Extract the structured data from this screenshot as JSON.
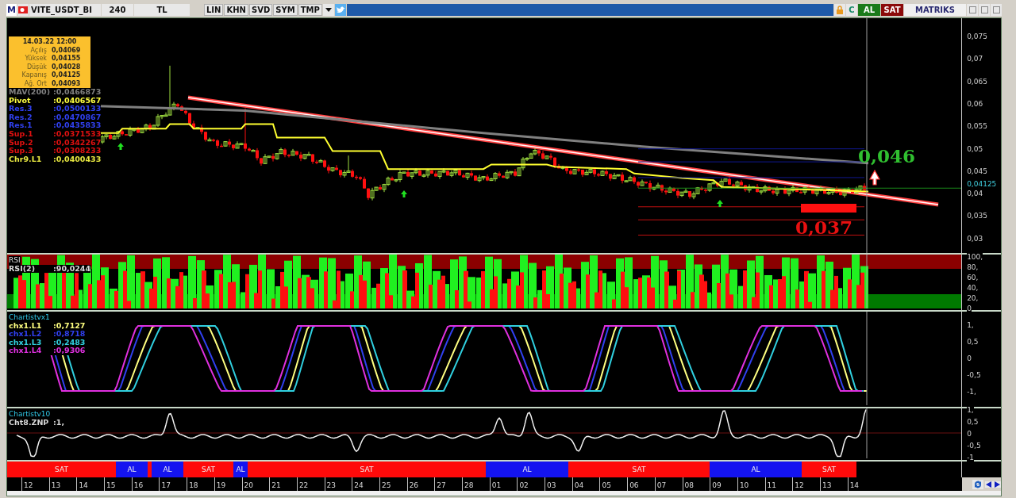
{
  "toolbar": {
    "logo": "M",
    "symbol": "VITE_USDT_BI",
    "period": "240",
    "currency": "TL",
    "chart_buttons": [
      "LIN",
      "KHN",
      "SVD",
      "SYM",
      "TMP"
    ],
    "refresh_button": "C",
    "buy_button": "AL",
    "sell_button": "SAT",
    "brand": "MATRIKS"
  },
  "info_box": {
    "datetime": "14.03.22 12:00",
    "rows": [
      {
        "label": "Açılış",
        "value": "0,04069"
      },
      {
        "label": "Yüksek",
        "value": "0,04155"
      },
      {
        "label": "Düşük",
        "value": "0,04028"
      },
      {
        "label": "Kapanış",
        "value": "0,04125"
      },
      {
        "label": "Ağ. Ort",
        "value": "0,04093"
      }
    ]
  },
  "price_panel": {
    "legend": [
      {
        "label": "MAV(200)",
        "value": ":0,0466873",
        "color": "#808080"
      },
      {
        "label": "Pivot",
        "value": ":0,0406567",
        "color": "#ffff40"
      },
      {
        "label": "Res.3",
        "value": ":0,0500133",
        "color": "#3040f0"
      },
      {
        "label": "Res.2",
        "value": ":0,0470867",
        "color": "#3040f0"
      },
      {
        "label": "Res.1",
        "value": ":0,0435833",
        "color": "#3040f0"
      },
      {
        "label": "Sup.1",
        "value": ":0,0371533",
        "color": "#e01010"
      },
      {
        "label": "Sup.2",
        "value": ":0,0342267",
        "color": "#e01010"
      },
      {
        "label": "Sup.3",
        "value": ":0,0308233",
        "color": "#e01010"
      },
      {
        "label": "Chr9.L1",
        "value": ":0,0400433",
        "color": "#e8e840"
      }
    ],
    "target_high": "0,046",
    "target_low": "0,037",
    "axis": [
      "0,075",
      "0,07",
      "0,065",
      "0,06",
      "0,055",
      "0,05",
      "0,045",
      "0,04",
      "0,035",
      "0,03"
    ],
    "last_price": "0,04125"
  },
  "rsi_panel": {
    "title": "RSI",
    "legend": [
      {
        "label": "RSI(2)",
        "value": ":90,0244"
      }
    ],
    "axis": [
      "100,",
      "80,",
      "60,",
      "40,",
      "20,",
      "0"
    ]
  },
  "oscillator_panel": {
    "title": "Chartistvx1",
    "legend": [
      {
        "label": "chx1.L1",
        "value": ":0,7127",
        "color": "#ffff80"
      },
      {
        "label": "chx1.L2",
        "value": ":0,8718",
        "color": "#3040f0"
      },
      {
        "label": "chx1.L3",
        "value": ":0,2483",
        "color": "#30d0e0"
      },
      {
        "label": "chx1.L4",
        "value": ":0,9306",
        "color": "#e030e0"
      }
    ],
    "axis": [
      "1,",
      "0,5",
      "0",
      "-0,5",
      "-1,"
    ]
  },
  "signal_panel": {
    "title": "Chartistv10",
    "legend": [
      {
        "label": "Cht8.ZNP",
        "value": ":1,"
      }
    ],
    "axis": [
      "1,",
      "0,5",
      "0",
      "-0,5",
      "-1"
    ]
  },
  "signal_band": [
    {
      "kind": "sell",
      "label": "SAT"
    },
    {
      "kind": "buy",
      "label": "AL"
    },
    {
      "kind": "sell"
    },
    {
      "kind": "buy",
      "label": "AL"
    },
    {
      "kind": "sell",
      "label": "SAT"
    },
    {
      "kind": "buy",
      "label": "AL"
    },
    {
      "kind": "sell",
      "label": "SAT"
    },
    {
      "kind": "buy",
      "label": "AL"
    },
    {
      "kind": "sell",
      "label": "SAT"
    },
    {
      "kind": "buy",
      "label": "AL"
    },
    {
      "kind": "sell",
      "label": "SAT"
    }
  ],
  "dates": [
    "12",
    "13",
    "14",
    "15",
    "16",
    "17",
    "18",
    "19",
    "20",
    "21",
    "22",
    "23",
    "24",
    "25",
    "26",
    "27",
    "28",
    "01",
    "02",
    "03",
    "04",
    "05",
    "06",
    "07",
    "08",
    "09",
    "10",
    "11",
    "12",
    "13",
    "14"
  ]
}
